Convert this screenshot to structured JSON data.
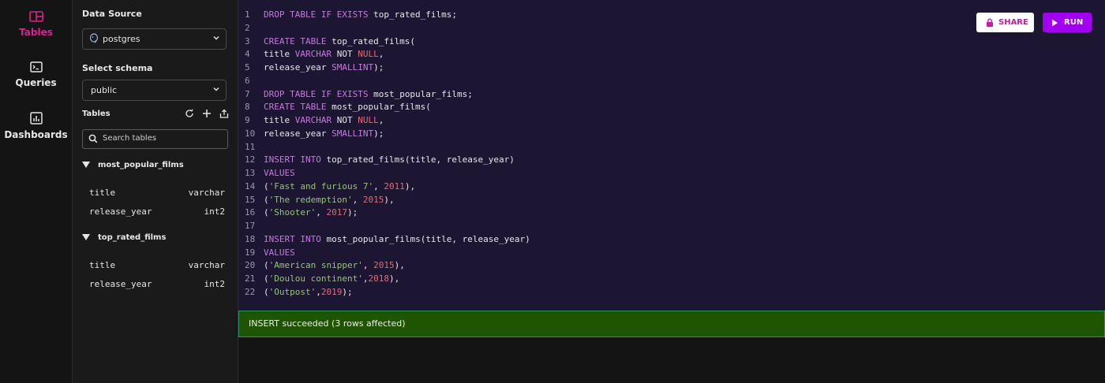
{
  "nav": {
    "items": [
      {
        "label": "Tables",
        "icon": "tables-icon",
        "active": true
      },
      {
        "label": "Queries",
        "icon": "terminal-icon",
        "active": false
      },
      {
        "label": "Dashboards",
        "icon": "chart-icon",
        "active": false
      }
    ]
  },
  "panel": {
    "data_source_label": "Data Source",
    "data_source_value": "postgres",
    "schema_label": "Select schema",
    "schema_value": "public",
    "tables_label": "Tables",
    "search_placeholder": "Search tables",
    "tables": [
      {
        "name": "most_popular_films",
        "columns": [
          {
            "name": "title",
            "type": "varchar"
          },
          {
            "name": "release_year",
            "type": "int2"
          }
        ]
      },
      {
        "name": "top_rated_films",
        "columns": [
          {
            "name": "title",
            "type": "varchar"
          },
          {
            "name": "release_year",
            "type": "int2"
          }
        ]
      }
    ]
  },
  "toolbar": {
    "share_label": "SHARE",
    "run_label": "RUN"
  },
  "editor": {
    "lines": [
      [
        [
          "kw",
          "DROP TABLE IF EXISTS "
        ],
        [
          "id",
          "top_rated_films;"
        ]
      ],
      [],
      [
        [
          "kw",
          "CREATE TABLE "
        ],
        [
          "id",
          "top_rated_films("
        ]
      ],
      [
        [
          "id",
          "title "
        ],
        [
          "kw",
          "VARCHAR "
        ],
        [
          "id",
          "NOT "
        ],
        [
          "nul",
          "NULL"
        ],
        [
          "pun",
          ","
        ]
      ],
      [
        [
          "id",
          "release_year "
        ],
        [
          "kw",
          "SMALLINT"
        ],
        [
          "pun",
          ");"
        ]
      ],
      [],
      [
        [
          "kw",
          "DROP TABLE IF EXISTS "
        ],
        [
          "id",
          "most_popular_films;"
        ]
      ],
      [
        [
          "kw",
          "CREATE TABLE "
        ],
        [
          "id",
          "most_popular_films("
        ]
      ],
      [
        [
          "id",
          "title "
        ],
        [
          "kw",
          "VARCHAR "
        ],
        [
          "id",
          "NOT "
        ],
        [
          "nul",
          "NULL"
        ],
        [
          "pun",
          ","
        ]
      ],
      [
        [
          "id",
          "release_year "
        ],
        [
          "kw",
          "SMALLINT"
        ],
        [
          "pun",
          ");"
        ]
      ],
      [],
      [
        [
          "kw",
          "INSERT INTO "
        ],
        [
          "id",
          "top_rated_films(title, release_year)"
        ]
      ],
      [
        [
          "kw",
          "VALUES"
        ]
      ],
      [
        [
          "pun",
          "("
        ],
        [
          "str",
          "'Fast and furious 7'"
        ],
        [
          "pun",
          ", "
        ],
        [
          "num",
          "2011"
        ],
        [
          "pun",
          "),"
        ]
      ],
      [
        [
          "pun",
          "("
        ],
        [
          "str",
          "'The redemption'"
        ],
        [
          "pun",
          ", "
        ],
        [
          "num",
          "2015"
        ],
        [
          "pun",
          "),"
        ]
      ],
      [
        [
          "pun",
          "("
        ],
        [
          "str",
          "'Shooter'"
        ],
        [
          "pun",
          ", "
        ],
        [
          "num",
          "2017"
        ],
        [
          "pun",
          ");"
        ]
      ],
      [],
      [
        [
          "kw",
          "INSERT INTO "
        ],
        [
          "id",
          "most_popular_films(title, release_year)"
        ]
      ],
      [
        [
          "kw",
          "VALUES"
        ]
      ],
      [
        [
          "pun",
          "("
        ],
        [
          "str",
          "'American snipper'"
        ],
        [
          "pun",
          ", "
        ],
        [
          "num",
          "2015"
        ],
        [
          "pun",
          "),"
        ]
      ],
      [
        [
          "pun",
          "("
        ],
        [
          "str",
          "'Doulou continent'"
        ],
        [
          "pun",
          ","
        ],
        [
          "num",
          "2018"
        ],
        [
          "pun",
          "),"
        ]
      ],
      [
        [
          "pun",
          "("
        ],
        [
          "str",
          "'Outpost'"
        ],
        [
          "pun",
          ","
        ],
        [
          "num",
          "2019"
        ],
        [
          "pun",
          ");"
        ]
      ]
    ]
  },
  "status": {
    "message": "INSERT succeeded (3 rows affected)"
  },
  "colors": {
    "accent": "#c020a0",
    "run": "#a200f0",
    "status_bg": "#1f5500",
    "editor_bg": "#1d1633"
  }
}
